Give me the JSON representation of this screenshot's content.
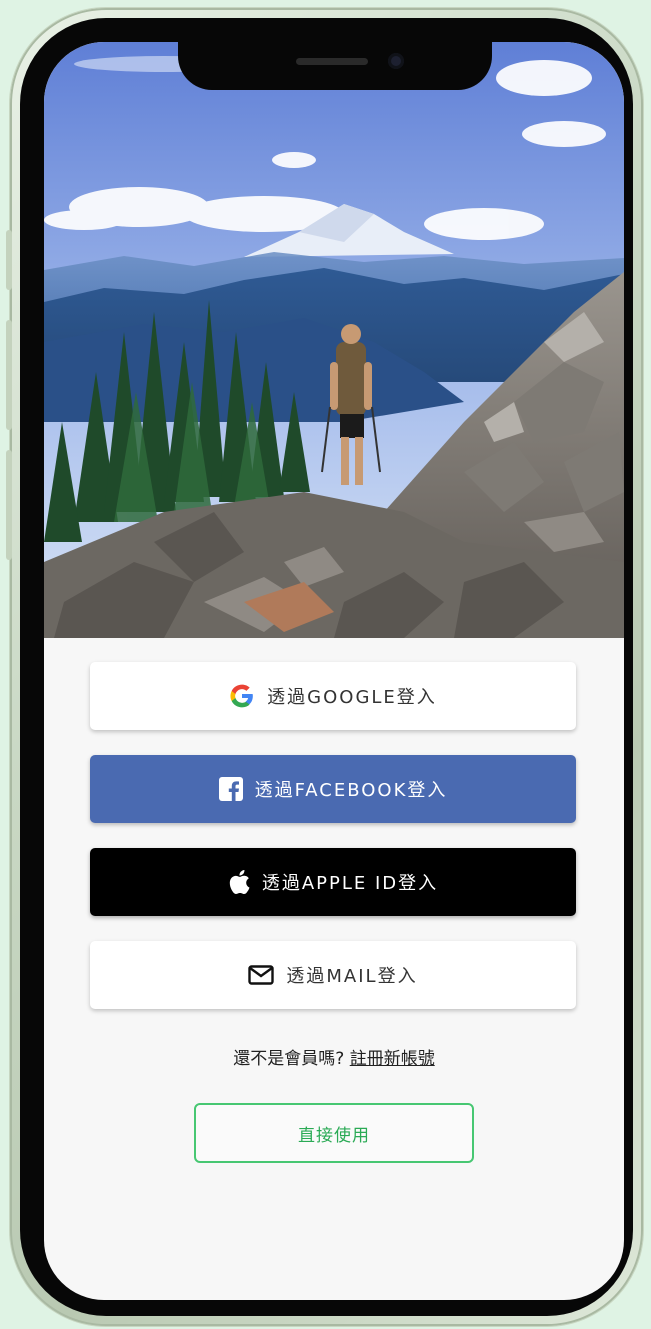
{
  "login": {
    "google_label": "透過GOOGLE登入",
    "facebook_label": "透過FACEBOOK登入",
    "apple_label": "透過APPLE ID登入",
    "mail_label": "透過MAIL登入"
  },
  "signup": {
    "prompt": "還不是會員嗎?",
    "link": "註冊新帳號"
  },
  "direct_use_label": "直接使用",
  "colors": {
    "facebook": "#4a6ab1",
    "apple": "#000000",
    "accent_green": "#47c772"
  },
  "icons": {
    "google": "google-icon",
    "facebook": "facebook-icon",
    "apple": "apple-icon",
    "mail": "mail-icon"
  }
}
